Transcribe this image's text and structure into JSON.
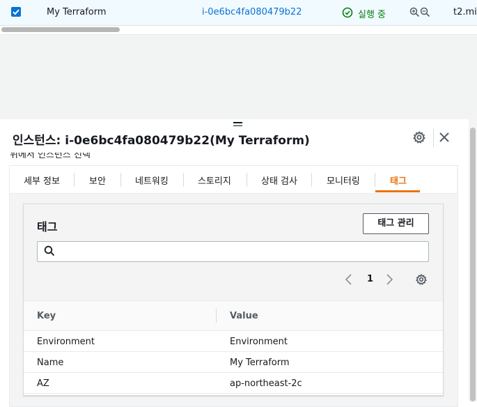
{
  "instance_row": {
    "name": "My Terraform",
    "instance_id": "i-0e6bc4fa080479b22",
    "status": "실행 중",
    "instance_type_partial": "t2.mi"
  },
  "split_panel": {
    "title": "인스턴스: i-0e6bc4fa080479b22(My Terraform)",
    "partially_hidden_text": "위에서 인스턴스 선택"
  },
  "tabs": [
    {
      "label": "세부 정보",
      "active": false
    },
    {
      "label": "보안",
      "active": false
    },
    {
      "label": "네트워킹",
      "active": false
    },
    {
      "label": "스토리지",
      "active": false
    },
    {
      "label": "상태 검사",
      "active": false
    },
    {
      "label": "모니터링",
      "active": false
    },
    {
      "label": "태그",
      "active": true
    }
  ],
  "tags_card": {
    "title": "태그",
    "manage_button": "태그 관리",
    "search_placeholder": "",
    "pagination": {
      "current_page": "1"
    },
    "columns": {
      "key": "Key",
      "value": "Value"
    },
    "rows": [
      {
        "key": "Environment",
        "value": "Environment"
      },
      {
        "key": "Name",
        "value": "My Terraform"
      },
      {
        "key": "AZ",
        "value": "ap-northeast-2c"
      }
    ]
  },
  "colors": {
    "link": "#0972d3",
    "success": "#037f0c",
    "active_tab": "#ec7211",
    "selected_row_bg": "#f1faff"
  },
  "icons": [
    "checkbox-checked-icon",
    "status-check-circle-icon",
    "zoom-in-icon",
    "zoom-out-icon",
    "drag-handle-icon",
    "settings-gear-icon",
    "close-icon",
    "search-icon",
    "chevron-left-icon",
    "chevron-right-icon",
    "preferences-gear-icon"
  ]
}
